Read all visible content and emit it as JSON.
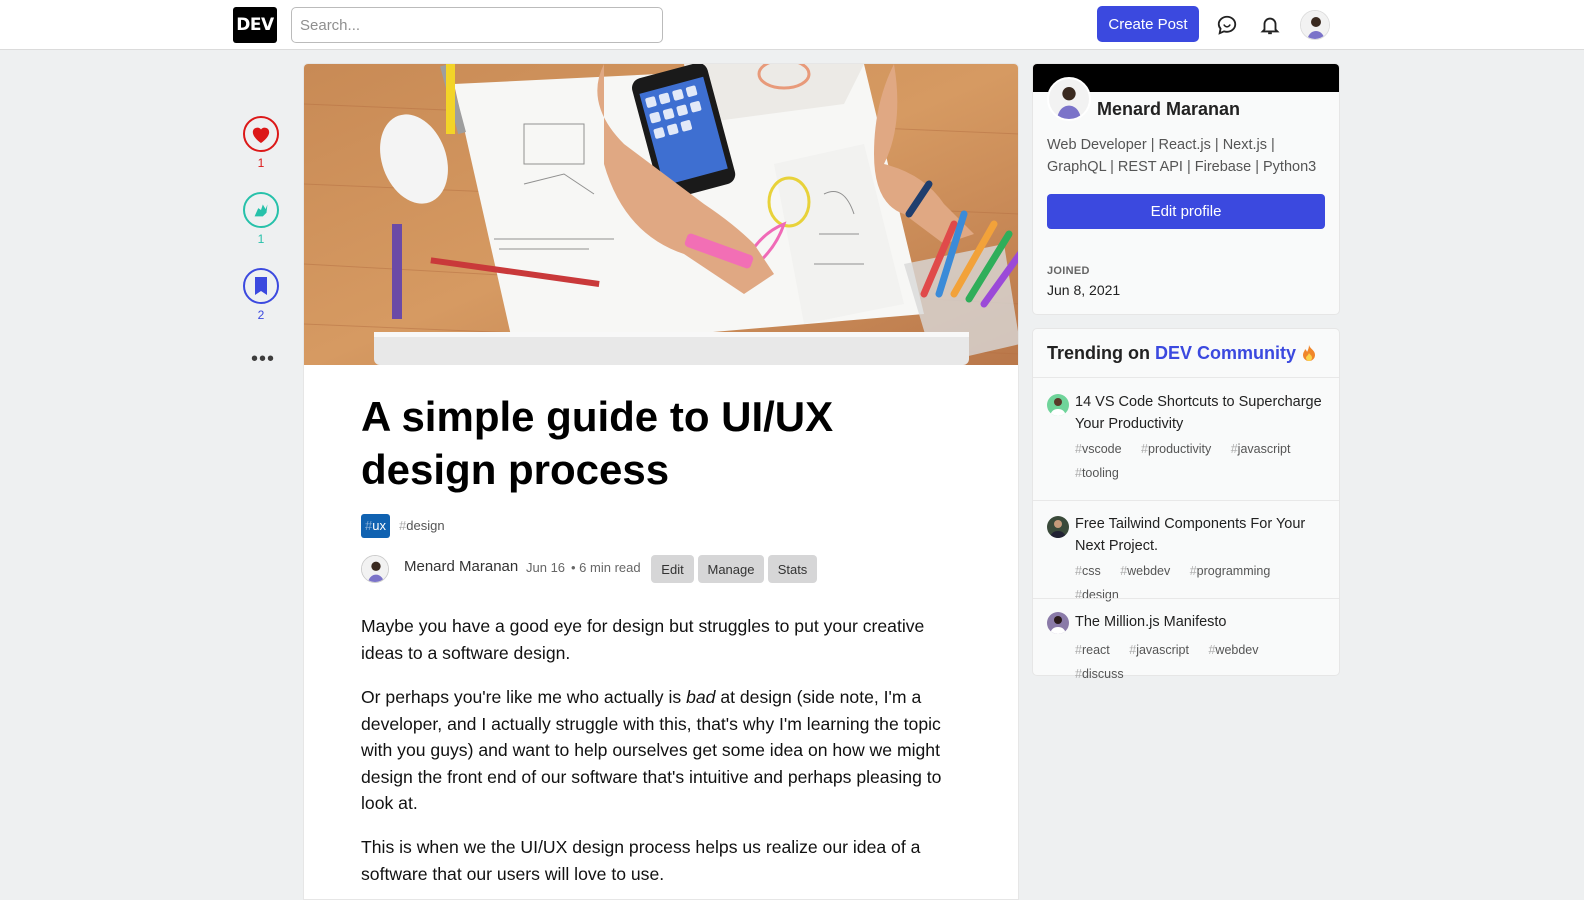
{
  "header": {
    "logo": "DEV",
    "search_placeholder": "Search...",
    "create_post": "Create Post"
  },
  "reactions": [
    {
      "name": "heart",
      "count": "1",
      "color": "#dc1818"
    },
    {
      "name": "unicorn",
      "count": "1",
      "color": "#26c1aa"
    },
    {
      "name": "bookmark",
      "count": "2",
      "color": "#3b49df"
    }
  ],
  "article": {
    "title": "A simple guide to UI/UX design process",
    "tags": [
      {
        "hash": "#",
        "name": "ux"
      },
      {
        "hash": "#",
        "name": "design"
      }
    ],
    "author": "Menard Maranan",
    "date": "Jun 16",
    "read_time": "• 6 min read",
    "actions": [
      "Edit",
      "Manage",
      "Stats"
    ],
    "paragraphs": [
      "Maybe you have a good eye for design but struggles to put your creative ideas to a software design.",
      "Or perhaps you're like me who actually is",
      "bad",
      "at design (side note, I'm a developer, and I actually struggle with this, that's why I'm learning the topic with you guys) and want to help ourselves get some idea on how we might design the front end of our software that's intuitive and perhaps pleasing to look at.",
      "This is when we the UI/UX design process helps us realize our idea of a software that our users will love to use."
    ]
  },
  "profile": {
    "name": "Menard Maranan",
    "bio": "Web Developer | React.js | Next.js | GraphQL | REST API | Firebase | Python3",
    "edit_button": "Edit profile",
    "joined_label": "JOINED",
    "joined_date": "Jun 8, 2021"
  },
  "trending": {
    "heading_prefix": "Trending on",
    "heading_brand": "DEV Community",
    "items": [
      {
        "title": "14 VS Code Shortcuts to Supercharge Your Productivity",
        "tags": [
          "vscode",
          "productivity",
          "javascript",
          "tooling"
        ]
      },
      {
        "title": "Free Tailwind Components For Your Next Project.",
        "tags": [
          "css",
          "webdev",
          "programming",
          "design"
        ]
      },
      {
        "title": "The Million.js Manifesto",
        "tags": [
          "react",
          "javascript",
          "webdev",
          "discuss"
        ]
      }
    ]
  }
}
